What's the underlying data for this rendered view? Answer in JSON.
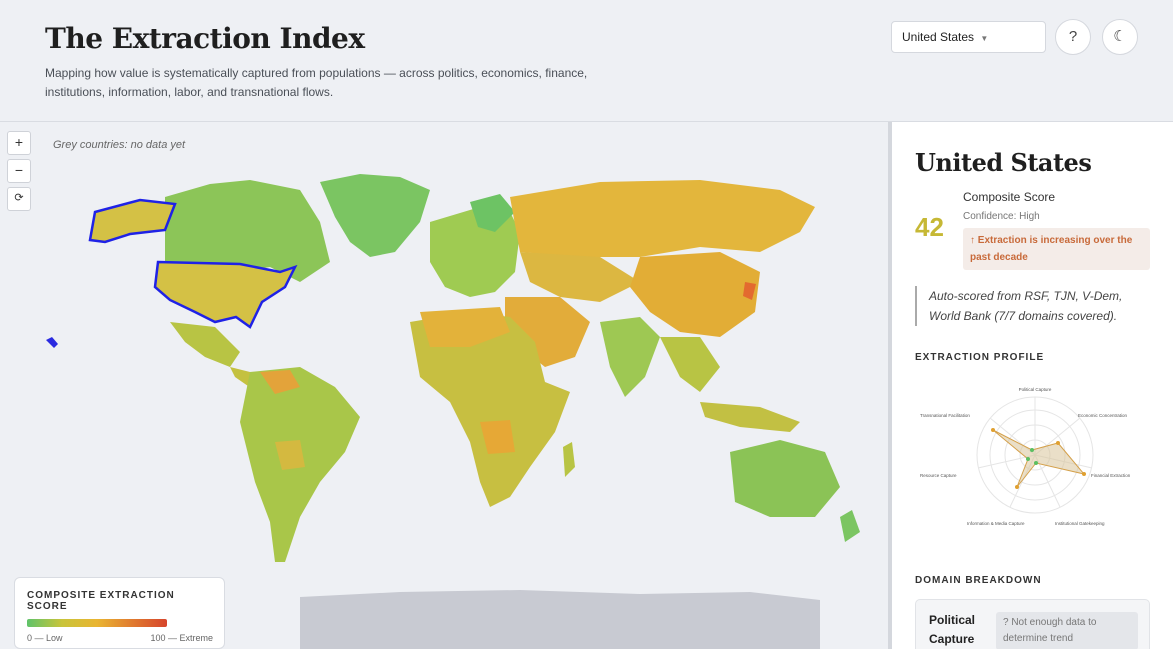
{
  "header": {
    "title": "The Extraction Index",
    "subtitle": "Mapping how value is systematically captured from populations — across politics, economics, finance, institutions, information, labor, and transnational flows.",
    "country_select_value": "United States",
    "help_button": "?",
    "theme_button": "☾"
  },
  "map": {
    "zoom_in": "+",
    "zoom_out": "−",
    "reset": "⟳",
    "grey_note": "Grey countries: no data yet",
    "selected_country": "United States",
    "legend": {
      "title": "COMPOSITE EXTRACTION SCORE",
      "low_label": "0 — Low",
      "high_label": "100 — Extreme",
      "colors": [
        "#5fc36a",
        "#c9c43a",
        "#e9b532",
        "#e07b2f",
        "#d6452c"
      ]
    }
  },
  "panel": {
    "country": "United States",
    "score": "42",
    "score_label": "Composite Score",
    "confidence": "Confidence: High",
    "trend": "↑ Extraction is increasing over the past decade",
    "source_note": "Auto-scored from RSF, TJN, V-Dem, World Bank (7/7 domains covered).",
    "profile_heading": "EXTRACTION PROFILE",
    "radar_axes": [
      "Political Capture",
      "Economic Concentration",
      "Financial Extraction",
      "Institutional Gatekeeping",
      "Information & Media Capture",
      "Resource Capture",
      "Transnational Facilitation"
    ],
    "breakdown_heading": "DOMAIN BREAKDOWN",
    "domains": [
      {
        "name": "Political Capture",
        "note": "? Not enough data to determine trend"
      }
    ]
  }
}
